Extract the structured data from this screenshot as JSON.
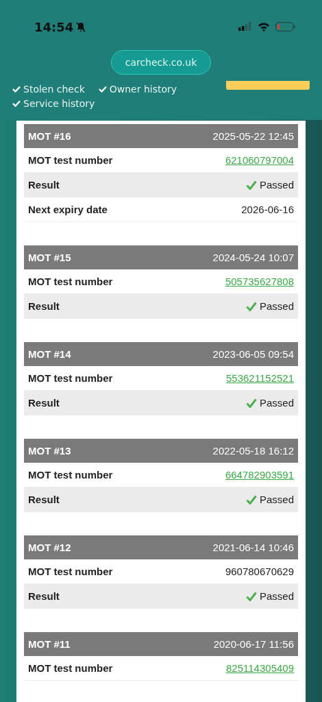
{
  "status_bar": {
    "time": "14:54",
    "silent": true,
    "battery_low": true
  },
  "site_button": "carcheck.co.uk",
  "features": [
    {
      "label": "Stolen check"
    },
    {
      "label": "Owner history"
    },
    {
      "label": "Service history"
    }
  ],
  "mot_tests": [
    {
      "title": "MOT #16",
      "date": "2025-05-22 12:45",
      "rows": [
        {
          "label": "MOT test number",
          "value": "621060797004",
          "kind": "link"
        },
        {
          "label": "Result",
          "value": "Passed",
          "kind": "result"
        },
        {
          "label": "Next expiry date",
          "value": "2026-06-16",
          "kind": "plain"
        }
      ]
    },
    {
      "title": "MOT #15",
      "date": "2024-05-24 10:07",
      "rows": [
        {
          "label": "MOT test number",
          "value": "505735627808",
          "kind": "link"
        },
        {
          "label": "Result",
          "value": "Passed",
          "kind": "result"
        }
      ]
    },
    {
      "title": "MOT #14",
      "date": "2023-06-05 09:54",
      "rows": [
        {
          "label": "MOT test number",
          "value": "553621152521",
          "kind": "link"
        },
        {
          "label": "Result",
          "value": "Passed",
          "kind": "result"
        }
      ]
    },
    {
      "title": "MOT #13",
      "date": "2022-05-18 16:12",
      "rows": [
        {
          "label": "MOT test number",
          "value": "664782903591",
          "kind": "link"
        },
        {
          "label": "Result",
          "value": "Passed",
          "kind": "result"
        }
      ]
    },
    {
      "title": "MOT #12",
      "date": "2021-06-14 10:46",
      "rows": [
        {
          "label": "MOT test number",
          "value": "960780670629",
          "kind": "plain"
        },
        {
          "label": "Result",
          "value": "Passed",
          "kind": "result"
        }
      ]
    },
    {
      "title": "MOT #11",
      "date": "2020-06-17 11:56",
      "rows": [
        {
          "label": "MOT test number",
          "value": "825114305409",
          "kind": "link"
        }
      ]
    }
  ]
}
